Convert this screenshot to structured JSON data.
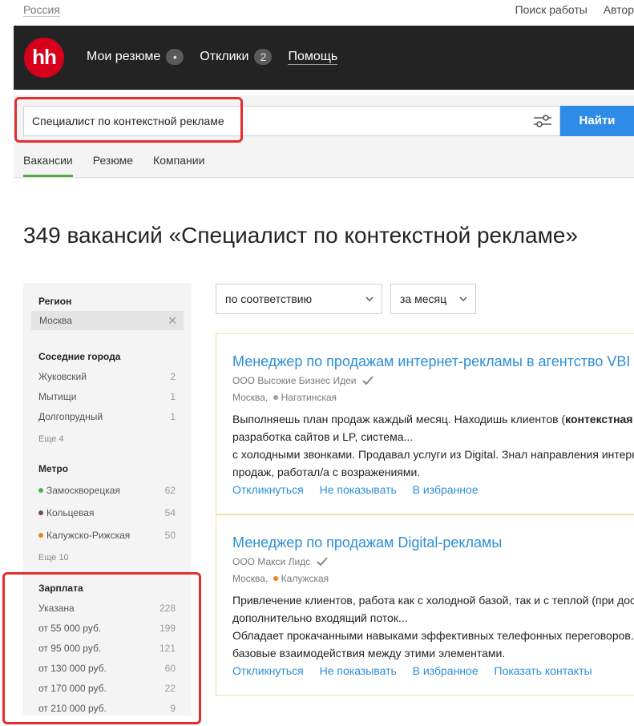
{
  "topbar": {
    "region": "Россия",
    "links": [
      "Поиск работы",
      "Автор"
    ]
  },
  "header": {
    "logo": "hh",
    "nav": [
      {
        "label": "Мои резюме",
        "badge": "•"
      },
      {
        "label": "Отклики",
        "badge": "2"
      },
      {
        "label": "Помощь",
        "badge": ""
      }
    ]
  },
  "search": {
    "value": "Специалист по контекстной рекламе",
    "button": "Найти"
  },
  "tabs": [
    "Вакансии",
    "Резюме",
    "Компании"
  ],
  "page_title": "349 вакансий «Специалист по контекстной рекламе»",
  "sidebar": {
    "region_heading": "Регион",
    "region_value": "Москва",
    "nearby_heading": "Соседние города",
    "nearby": [
      {
        "label": "Жуковский",
        "count": "2"
      },
      {
        "label": "Мытищи",
        "count": "1"
      },
      {
        "label": "Долгопрудный",
        "count": "1"
      }
    ],
    "nearby_more": "Еще 4",
    "metro_heading": "Метро",
    "metro": [
      {
        "label": "Замоскворецкая",
        "count": "62",
        "color": "#4caf50"
      },
      {
        "label": "Кольцевая",
        "count": "54",
        "color": "#6d4c41"
      },
      {
        "label": "Калужско-Рижская",
        "count": "50",
        "color": "#ef7f1a"
      }
    ],
    "metro_more": "Еще 10",
    "salary_heading": "Зарплата",
    "salary": [
      {
        "label": "Указана",
        "count": "228"
      },
      {
        "label": "от 55 000 руб.",
        "count": "199"
      },
      {
        "label": "от 95 000 руб.",
        "count": "121"
      },
      {
        "label": "от 130 000 руб.",
        "count": "60"
      },
      {
        "label": "от 170 000 руб.",
        "count": "22"
      },
      {
        "label": "от 210 000 руб.",
        "count": "9"
      }
    ]
  },
  "sort": {
    "order": "по соответствию",
    "period": "за месяц"
  },
  "vacancies": [
    {
      "title": "Менеджер по продажам интернет-рекламы в агентство VBI",
      "company": "ООО Высокие Бизнес Идеи",
      "city": "Москва,",
      "metro": "Нагатинская",
      "metro_color": "#9e9e9e",
      "text_line1_pre": "Выполняешь план продаж каждый месяц. Находишь клиентов (",
      "text_line1_bold": "контекстная",
      "text_line2": "разработка сайтов и LP, система...",
      "text_line3": "с холодными звонками. Продавал услуги из Digital. Знал направления интерн",
      "text_line4": "продаж, работал/а с возражениями.",
      "actions": [
        "Откликнуться",
        "Не показывать",
        "В избранное"
      ]
    },
    {
      "title": "Менеджер по продажам Digital-рекламы",
      "company": "ООО Макси Лидс",
      "city": "Москва,",
      "metro": "Калужская",
      "metro_color": "#ef7f1a",
      "text_line1": "Привлечение клиентов, работа как с холодной базой, так и с теплой (при дос",
      "text_line2": "дополнительно входящий поток...",
      "text_line3": "Обладает прокачанными навыками эффективных телефонных переговоров.",
      "text_line4": "базовые взаимодействия между этими элементами.",
      "actions": [
        "Откликнуться",
        "Не показывать",
        "В избранное",
        "Показать контакты"
      ]
    }
  ]
}
